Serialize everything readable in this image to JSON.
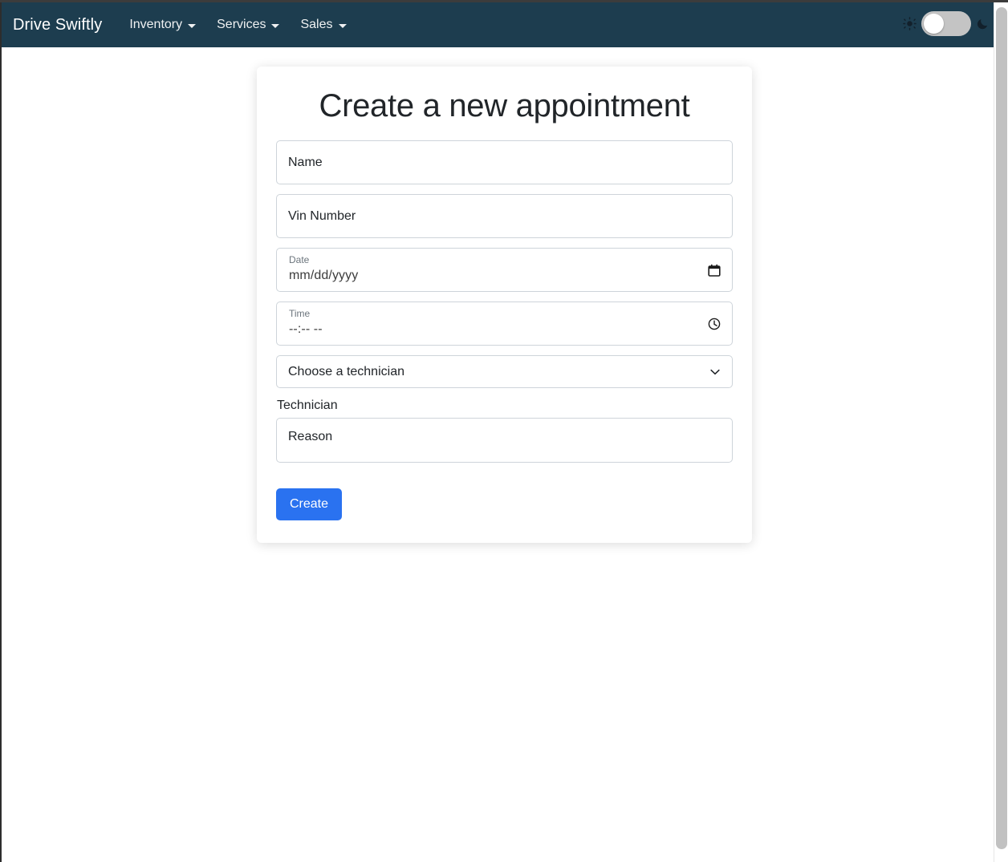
{
  "navbar": {
    "brand": "Drive Swiftly",
    "items": [
      {
        "label": "Inventory",
        "has_caret": true
      },
      {
        "label": "Services",
        "has_caret": true
      },
      {
        "label": "Sales",
        "has_caret": true
      }
    ],
    "theme_toggle": {
      "left_icon": "sun-icon",
      "right_icon": "moon-icon",
      "state": "off",
      "background": "#c4c4c4",
      "knob_color": "#ffffff"
    },
    "background": "#1d3d4f",
    "text_color": "#ffffff"
  },
  "card": {
    "title": "Create a new appointment",
    "fields": {
      "name": {
        "placeholder": "Name"
      },
      "vin": {
        "placeholder": "Vin Number"
      },
      "date": {
        "label": "Date",
        "value": "mm/dd/yyyy",
        "icon": "calendar-icon"
      },
      "time": {
        "label": "Time",
        "value": "--:-- --",
        "icon": "clock-icon"
      },
      "technician_select": {
        "selected": "Choose a technician",
        "icon": "chevron-down-icon"
      },
      "technician_label": "Technician",
      "reason": {
        "placeholder": "Reason"
      }
    },
    "submit_button": {
      "label": "Create",
      "color": "#2a72f0"
    }
  }
}
